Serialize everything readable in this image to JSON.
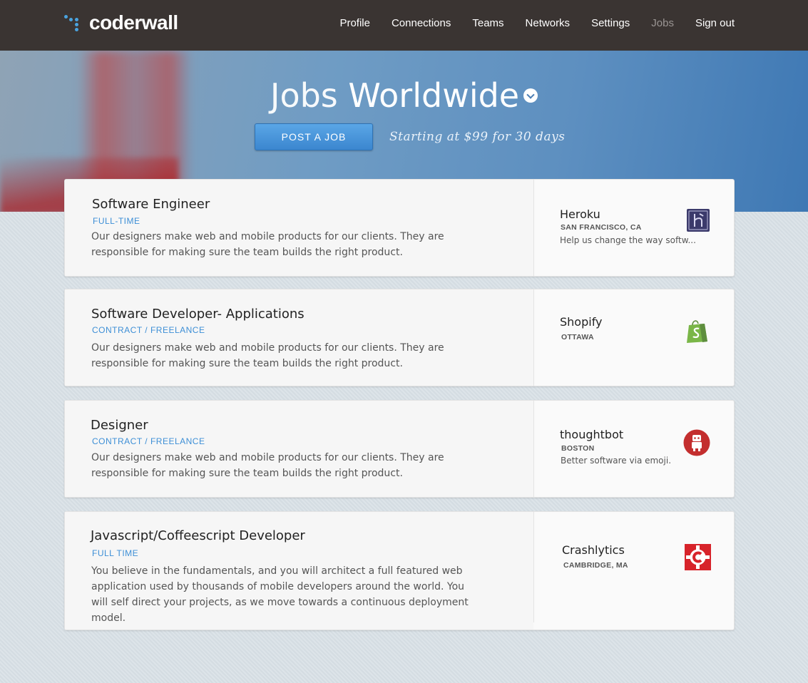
{
  "app": {
    "name": "coderwall"
  },
  "nav": {
    "items": [
      {
        "label": "Profile"
      },
      {
        "label": "Connections"
      },
      {
        "label": "Teams"
      },
      {
        "label": "Networks"
      },
      {
        "label": "Settings"
      },
      {
        "label": "Jobs",
        "active": true
      },
      {
        "label": "Sign out"
      }
    ]
  },
  "hero": {
    "title_light": "Jobs",
    "title_bold": "Worldwide",
    "post_button": "POST A JOB",
    "tagline": "Starting at $99 for 30 days"
  },
  "jobs": [
    {
      "title": "Software Engineer",
      "type": "FULL-TIME",
      "description": "Our designers make web and mobile products for our clients. They are responsible for making sure the team builds the right product.",
      "company": "Heroku",
      "location": "SAN FRANCISCO, CA",
      "company_tagline": "Help us change the way softw...",
      "logo_icon": "heroku-logo-icon",
      "logo_color": "#3b3a6b"
    },
    {
      "title": "Software Developer- Applications",
      "type": "CONTRACT / FREELANCE",
      "description": "Our designers make web and mobile products for our clients. They are responsible for making sure the team builds the right product.",
      "company": "Shopify",
      "location": "OTTAWA",
      "company_tagline": "",
      "logo_icon": "shopify-bag-icon",
      "logo_color": "#7ab648"
    },
    {
      "title": "Designer",
      "type": "CONTRACT / FREELANCE",
      "description": "Our designers make web and mobile products for our clients. They are responsible for making sure the team builds the right product.",
      "company": "thoughtbot",
      "location": "BOSTON",
      "company_tagline": "Better software via emoji.",
      "logo_icon": "thoughtbot-robot-icon",
      "logo_color": "#c32e2e"
    },
    {
      "title": "Javascript/Coffeescript Developer",
      "type": "FULL TIME",
      "description": "You believe in the fundamentals, and you will architect a full featured web application used by thousands of mobile developers around the world. You will self direct your projects, as we move towards a continuous deployment model.",
      "company": "Crashlytics",
      "location": "CAMBRIDGE, MA",
      "company_tagline": "",
      "logo_icon": "crashlytics-gear-icon",
      "logo_color": "#d7232a"
    }
  ],
  "colors": {
    "topbar": "#3a3432",
    "accent_blue": "#3d8fd6",
    "nav_active": "#9a9593"
  }
}
